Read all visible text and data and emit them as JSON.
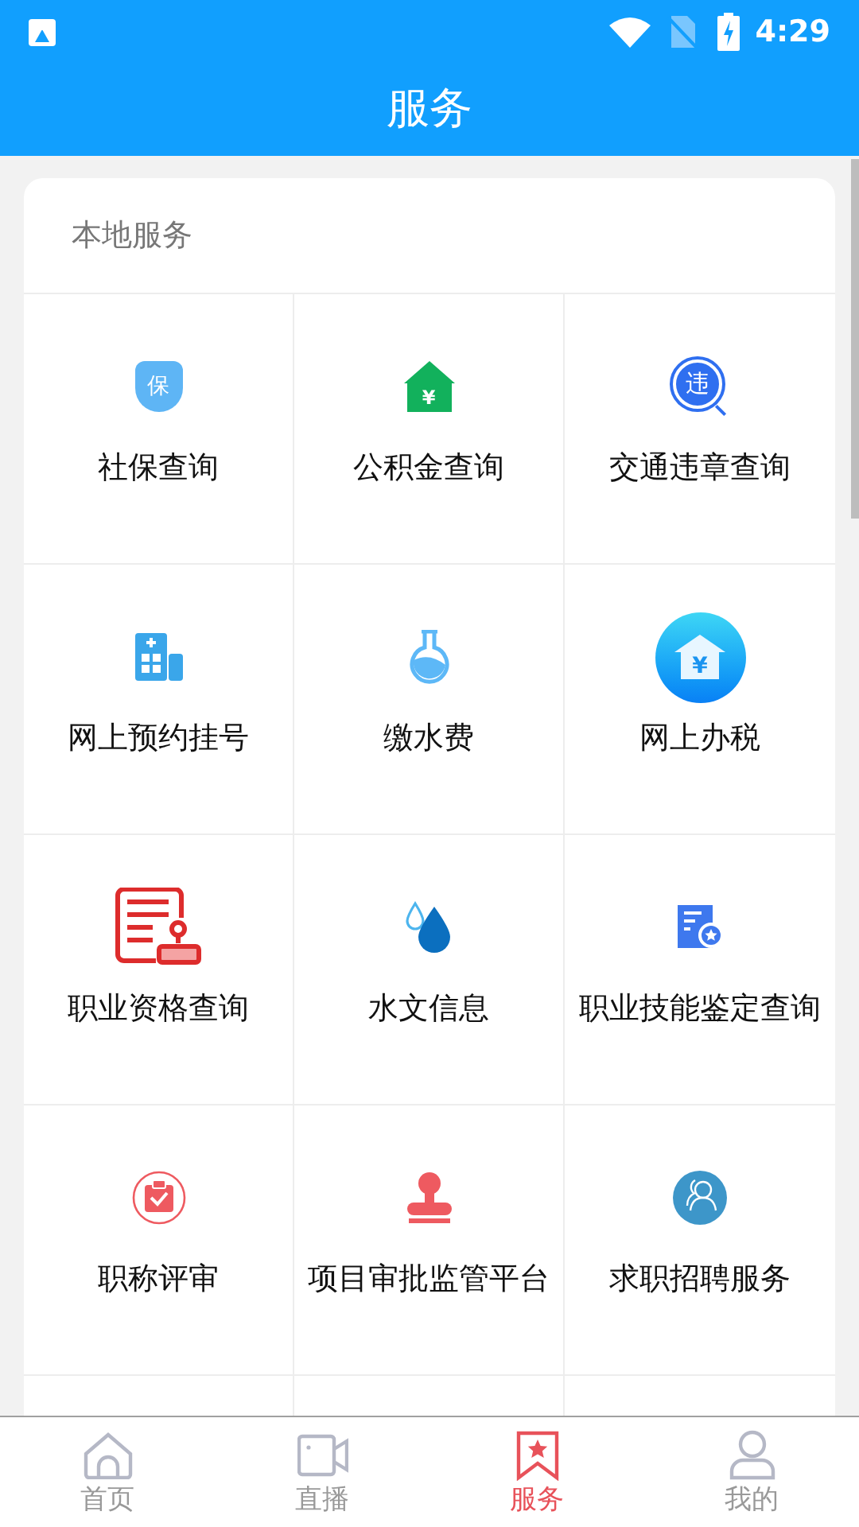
{
  "status_bar": {
    "time": "4:29"
  },
  "header": {
    "title": "服务"
  },
  "section": {
    "title": "本地服务",
    "items": [
      {
        "label": "社保查询",
        "kind": "shield",
        "glyph": "保"
      },
      {
        "label": "公积金查询",
        "kind": "house-money",
        "glyph": "¥"
      },
      {
        "label": "交通违章查询",
        "kind": "magnifier",
        "glyph": "违"
      },
      {
        "label": "网上预约挂号",
        "kind": "hospital"
      },
      {
        "label": "缴水费",
        "kind": "flask"
      },
      {
        "label": "网上办税",
        "kind": "tax",
        "glyph": "¥"
      },
      {
        "label": "职业资格查询",
        "kind": "certificate"
      },
      {
        "label": "水文信息",
        "kind": "drops"
      },
      {
        "label": "职业技能鉴定查询",
        "kind": "document-star"
      },
      {
        "label": "职称评审",
        "kind": "clipboard-check"
      },
      {
        "label": "项目审批监管平台",
        "kind": "stamp"
      },
      {
        "label": "求职招聘服务",
        "kind": "people"
      }
    ]
  },
  "tab_bar": [
    {
      "label": "首页",
      "kind": "home",
      "selected": false
    },
    {
      "label": "直播",
      "kind": "video",
      "selected": false
    },
    {
      "label": "服务",
      "kind": "bookmark",
      "selected": true
    },
    {
      "label": "我的",
      "kind": "user",
      "selected": false
    }
  ]
}
